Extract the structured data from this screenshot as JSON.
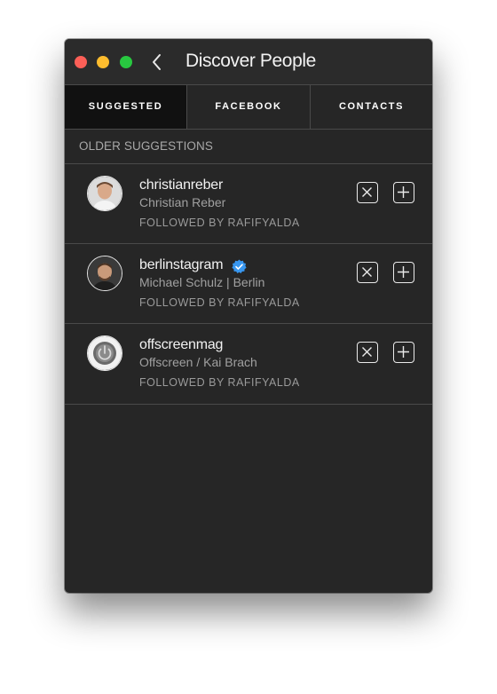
{
  "window": {
    "title": "Discover People",
    "traffic_lights": [
      "close",
      "minimize",
      "zoom"
    ],
    "back_icon": "chevron-left-icon"
  },
  "tabs": [
    {
      "label": "SUGGESTED",
      "active": true
    },
    {
      "label": "FACEBOOK",
      "active": false
    },
    {
      "label": "CONTACTS",
      "active": false
    }
  ],
  "section": {
    "label": "OLDER SUGGESTIONS"
  },
  "suggestions": [
    {
      "username": "christianreber",
      "full_name": "Christian Reber",
      "followed_by": "FOLLOWED BY RAFIFYALDA",
      "verified": false
    },
    {
      "username": "berlinstagram",
      "full_name": "Michael Schulz | Berlin",
      "followed_by": "FOLLOWED BY RAFIFYALDA",
      "verified": true
    },
    {
      "username": "offscreenmag",
      "full_name": "Offscreen / Kai Brach",
      "followed_by": "FOLLOWED BY RAFIFYALDA",
      "verified": false
    }
  ],
  "icons": {
    "dismiss": "close-icon",
    "follow": "plus-icon",
    "verified": "verified-badge-icon"
  },
  "colors": {
    "window_bg": "#262626",
    "tab_active_bg": "#111111",
    "verified_blue": "#3897f0",
    "divider": "#4a4a4a"
  }
}
